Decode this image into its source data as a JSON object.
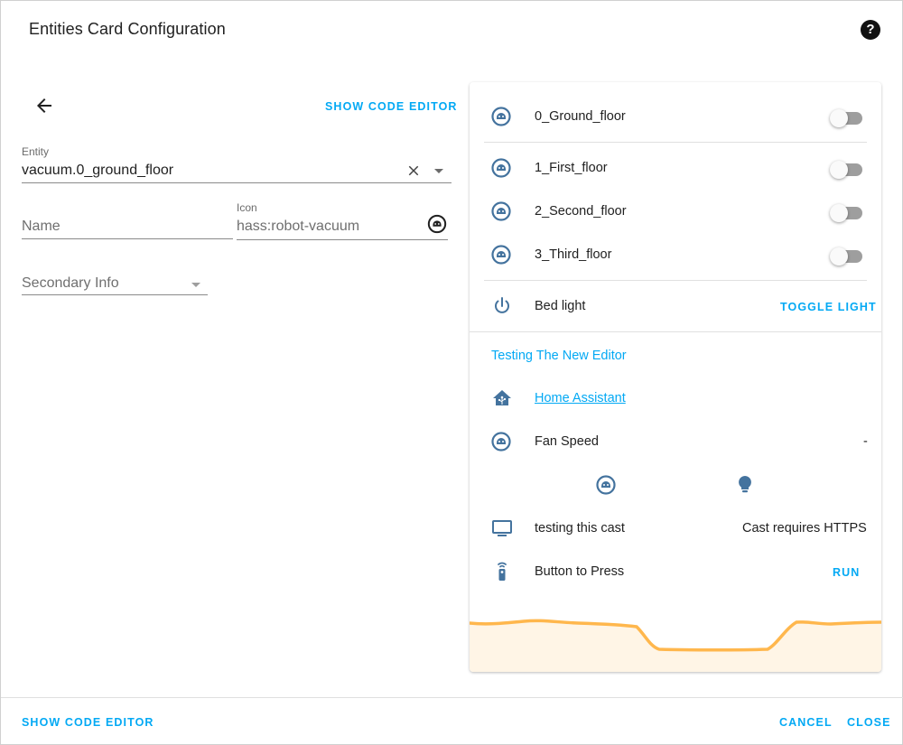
{
  "dialog": {
    "title": "Entities Card Configuration",
    "help_icon": "help-circle-icon"
  },
  "editor": {
    "show_code_editor": "SHOW CODE EDITOR",
    "entity": {
      "label": "Entity",
      "value": "vacuum.0_ground_floor"
    },
    "name": {
      "placeholder": "Name"
    },
    "icon": {
      "label": "Icon",
      "value": "hass:robot-vacuum"
    },
    "secondary_info": {
      "placeholder": "Secondary Info"
    }
  },
  "preview": {
    "rows": [
      {
        "name": "0_Ground_floor",
        "icon": "robot-vacuum-icon",
        "toggle": false
      },
      {
        "name": "1_First_floor",
        "icon": "robot-vacuum-icon",
        "toggle": false
      },
      {
        "name": "2_Second_floor",
        "icon": "robot-vacuum-icon",
        "toggle": false
      },
      {
        "name": "3_Third_floor",
        "icon": "robot-vacuum-icon",
        "toggle": false
      }
    ],
    "bed_light": {
      "name": "Bed light",
      "icon": "power-icon",
      "action": "TOGGLE LIGHT"
    },
    "section_title": "Testing The New Editor",
    "weblink": {
      "name": "Home Assistant",
      "icon": "home-assistant-icon"
    },
    "fan_speed": {
      "name": "Fan Speed",
      "state": "-"
    },
    "buttons_row": [
      "robot-vacuum-icon",
      "lightbulb-icon"
    ],
    "cast": {
      "name": "testing this cast",
      "state": "Cast requires HTTPS",
      "icon": "television-icon"
    },
    "button": {
      "name": "Button to Press",
      "action": "RUN",
      "icon": "remote-icon"
    },
    "graph": {
      "stroke_color": "#ffb74d",
      "fill_color": "#fff5e6"
    }
  },
  "footer": {
    "show_code_editor": "SHOW CODE EDITOR",
    "cancel": "CANCEL",
    "close": "CLOSE"
  },
  "colors": {
    "accent": "#03a9f4",
    "icon": "#44739e"
  }
}
